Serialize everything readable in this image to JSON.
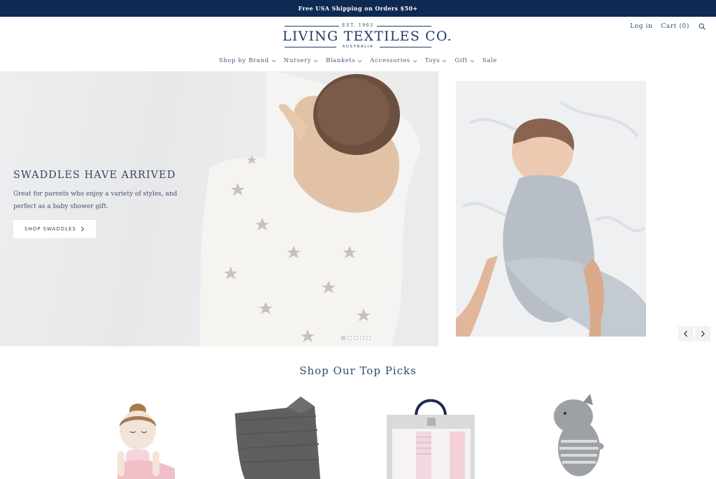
{
  "announcement": "Free USA Shipping on Orders $50+",
  "logo": {
    "est": "EST. 1963",
    "name": "LIVING TEXTILES CO.",
    "sub": "AUSTRALIA"
  },
  "header_links": {
    "login": "Log in",
    "cart": "Cart (0)",
    "search_icon": "search-icon"
  },
  "nav": [
    {
      "label": "Shop by Brand",
      "dropdown": true
    },
    {
      "label": "Nursery",
      "dropdown": true
    },
    {
      "label": "Blankets",
      "dropdown": true
    },
    {
      "label": "Accessories",
      "dropdown": true
    },
    {
      "label": "Toys",
      "dropdown": true
    },
    {
      "label": "Gift",
      "dropdown": true
    },
    {
      "label": "Sale",
      "dropdown": false
    }
  ],
  "hero": {
    "title": "SWADDLES HAVE ARRIVED",
    "description": "Great for parents who enjoy a variety of styles, and perfect as a baby shower gift.",
    "button": "SHOP SWADDLES",
    "slide_count": 5,
    "active_slide": 1
  },
  "section": {
    "title": "Shop Our Top Picks"
  },
  "colors": {
    "announcement_bg": "#0f2a52",
    "brand_navy": "#213a6b",
    "heading_blue": "#2d4a78"
  }
}
